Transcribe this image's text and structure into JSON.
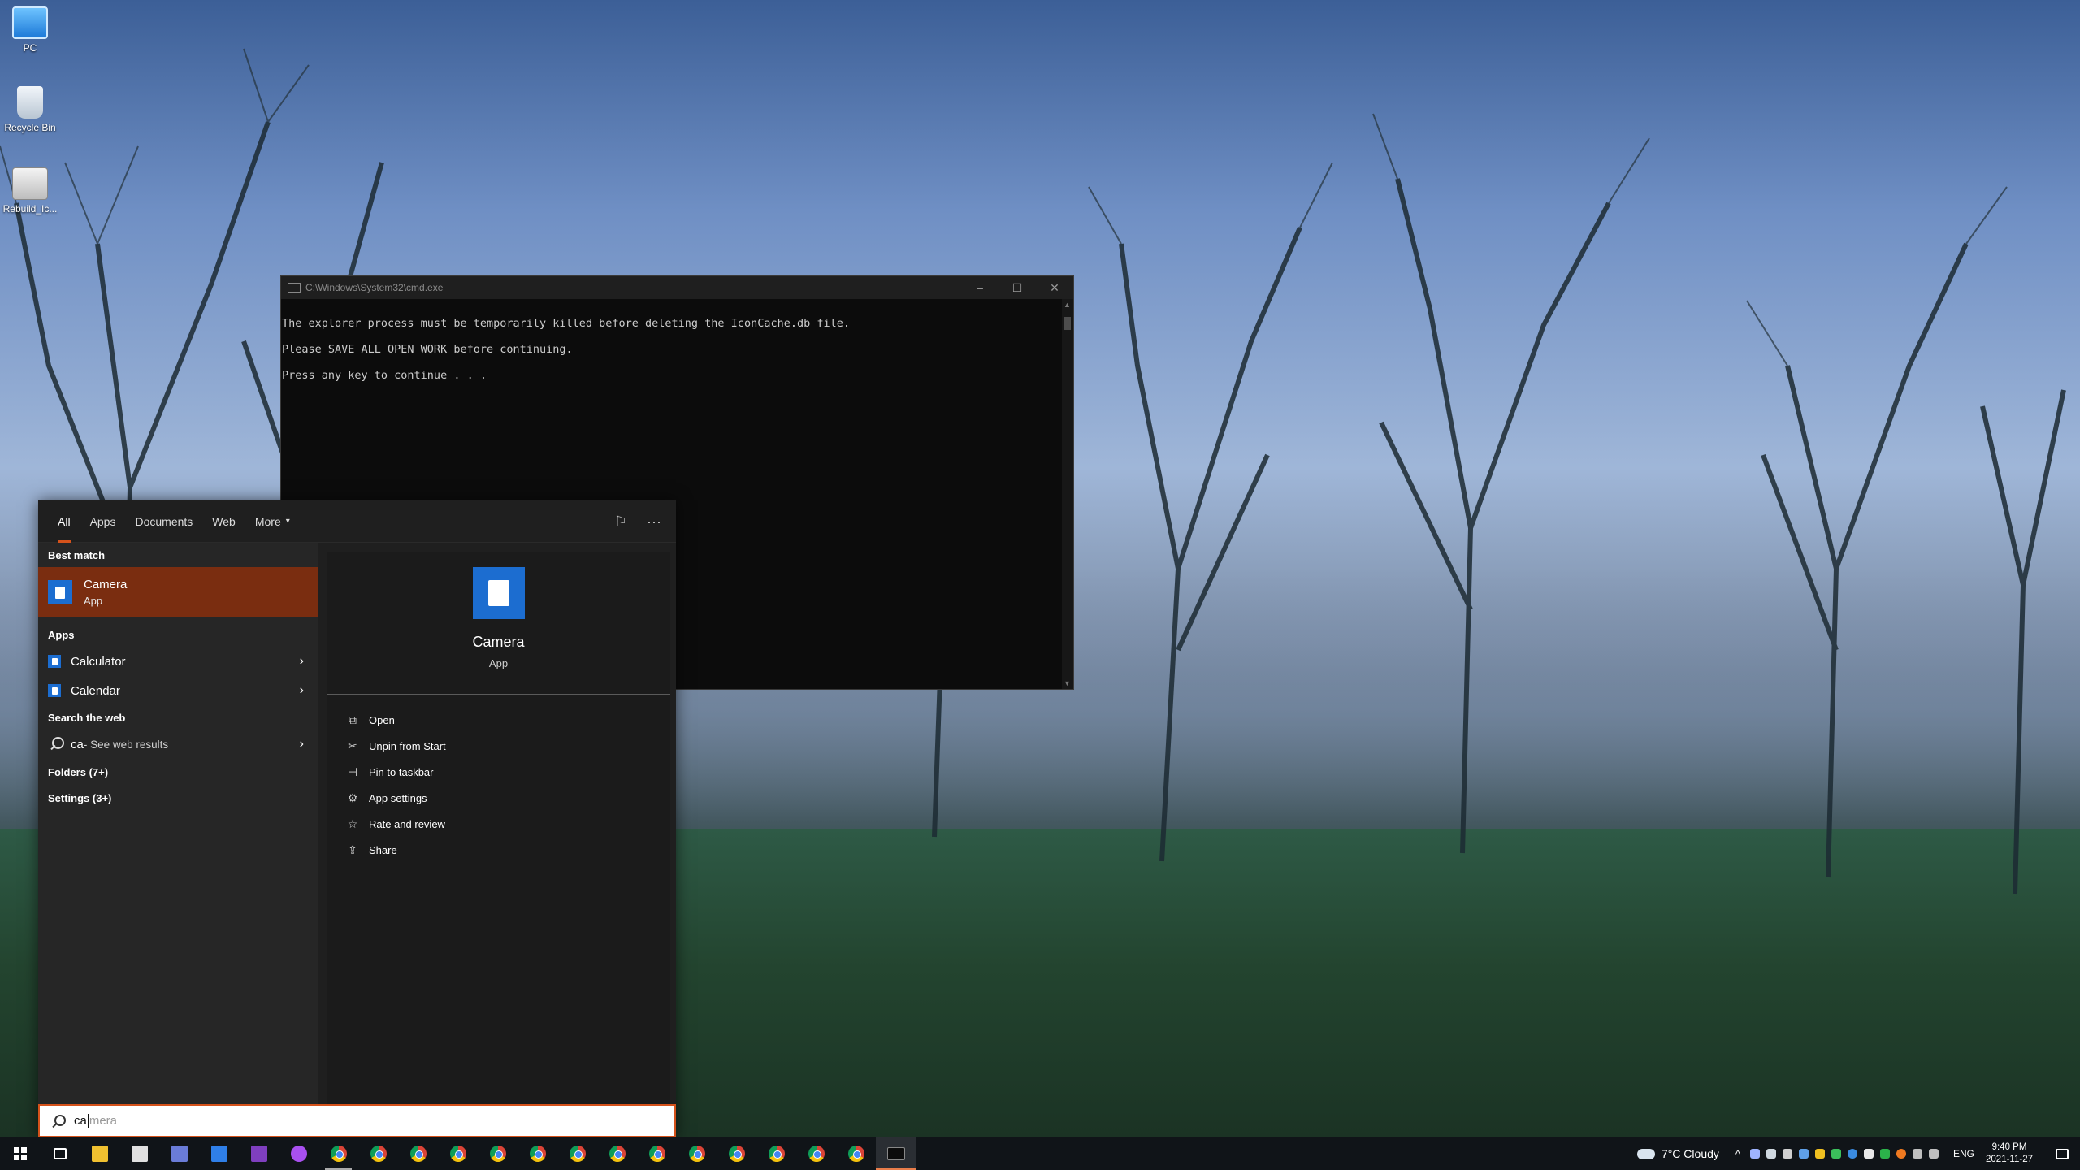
{
  "desktop": {
    "icons": [
      {
        "label": "PC",
        "icon": "this-pc-icon"
      },
      {
        "label": "Recycle Bin",
        "icon": "recycle-bin-icon"
      },
      {
        "label": "Rebuild_Ic...",
        "icon": "batch-file-icon"
      }
    ]
  },
  "cmd": {
    "title": "C:\\Windows\\System32\\cmd.exe",
    "lines": [
      "The explorer process must be temporarily killed before deleting the IconCache.db file.",
      "Please SAVE ALL OPEN WORK before continuing.",
      "Press any key to continue . . ."
    ],
    "minimize": "–",
    "maximize": "☐",
    "close": "✕"
  },
  "search": {
    "tabs": [
      {
        "label": "All",
        "active": true
      },
      {
        "label": "Apps"
      },
      {
        "label": "Documents"
      },
      {
        "label": "Web"
      },
      {
        "label": "More"
      }
    ],
    "more_caret": "▾",
    "feedback_icon": "⚐",
    "options_icon": "···",
    "best_match_heading": "Best match",
    "best_match": {
      "name": "Camera",
      "type": "App"
    },
    "apps_heading": "Apps",
    "apps": [
      {
        "name": "Calculator"
      },
      {
        "name": "Calendar"
      }
    ],
    "web_heading": "Search the web",
    "web_query": "ca",
    "web_hint": " - See web results",
    "folders_link": "Folders (7+)",
    "settings_link": "Settings (3+)",
    "chevron": "›",
    "detail": {
      "name": "Camera",
      "type": "App",
      "actions": [
        {
          "label": "Open",
          "icon": "open-icon",
          "glyph": "⧉"
        },
        {
          "label": "Unpin from Start",
          "icon": "unpin-icon",
          "glyph": "✂"
        },
        {
          "label": "Pin to taskbar",
          "icon": "pin-icon",
          "glyph": "⊣"
        },
        {
          "label": "App settings",
          "icon": "gear-icon",
          "glyph": "⚙"
        },
        {
          "label": "Rate and review",
          "icon": "star-icon",
          "glyph": "☆"
        },
        {
          "label": "Share",
          "icon": "share-icon",
          "glyph": "⇪"
        }
      ]
    },
    "input": {
      "typed": "ca",
      "suggestion": "mera"
    }
  },
  "taskbar": {
    "weather": "7°C  Cloudy",
    "language": "ENG",
    "time": "9:40 PM",
    "date": "2021-11-27",
    "tray_chevron": "^",
    "colors": {
      "accent": "#d5521b",
      "best_match_bg": "#7a2d10",
      "taskbar_bg": "#101418"
    }
  }
}
